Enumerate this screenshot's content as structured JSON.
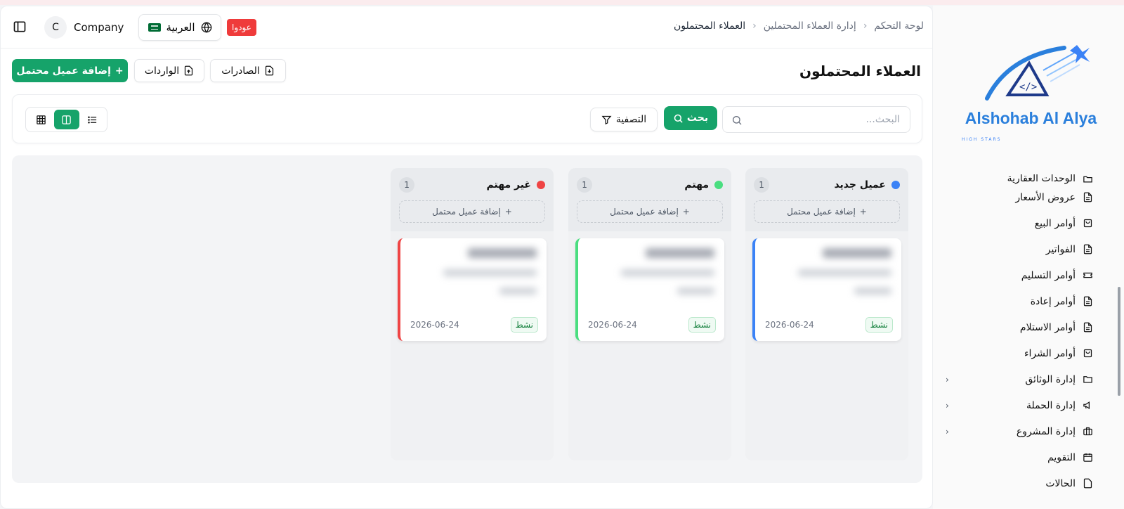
{
  "header": {
    "company_initial": "C",
    "company_name": "Company",
    "language_label": "العربية",
    "back_badge": "عودوا",
    "breadcrumb": [
      "لوحة التحكم",
      "إدارة العملاء المحتملين",
      "العملاء المحتملون"
    ]
  },
  "page": {
    "title": "العملاء المحتملون",
    "add_button": "إضافة عميل محتمل",
    "imports_button": "الواردات",
    "exports_button": "الصادرات"
  },
  "toolbar": {
    "search_placeholder": "البحث...",
    "search_button": "بحث",
    "filter_button": "التصفية"
  },
  "board": {
    "columns": [
      {
        "title": "عميل جديد",
        "count": "1",
        "color": "#3b82f6",
        "add_label": "إضافة عميل محتمل",
        "card": {
          "date": "2026-06-24",
          "status": "نشط"
        }
      },
      {
        "title": "مهتم",
        "count": "1",
        "color": "#4ade80",
        "add_label": "إضافة عميل محتمل",
        "card": {
          "date": "2026-06-24",
          "status": "نشط"
        }
      },
      {
        "title": "غير مهتم",
        "count": "1",
        "color": "#ef4444",
        "add_label": "إضافة عميل محتمل",
        "card": {
          "date": "2026-06-24",
          "status": "نشط"
        }
      }
    ]
  },
  "sidebar": {
    "brand": "Alshohab Al Alya",
    "tagline": "HIGH STARS",
    "items": [
      {
        "label": "الوحدات العقارية",
        "icon": "folder-icon"
      },
      {
        "label": "عروض الأسعار",
        "icon": "document-icon"
      },
      {
        "label": "أوامر البيع",
        "icon": "shopping-bag-icon"
      },
      {
        "label": "الفواتير",
        "icon": "document-icon"
      },
      {
        "label": "أوامر التسليم",
        "icon": "ticket-icon"
      },
      {
        "label": "أوامر إعادة",
        "icon": "document-icon"
      },
      {
        "label": "أوامر الاستلام",
        "icon": "document-icon"
      },
      {
        "label": "أوامر الشراء",
        "icon": "shopping-bag-icon"
      },
      {
        "label": "إدارة الوثائق",
        "icon": "folder-icon"
      },
      {
        "label": "إدارة الحملة",
        "icon": "megaphone-icon"
      },
      {
        "label": "إدارة المشروع",
        "icon": "briefcase-icon"
      },
      {
        "label": "التقويم",
        "icon": "calendar-icon"
      },
      {
        "label": "الحالات",
        "icon": "document-icon"
      }
    ]
  },
  "colors": {
    "accent": "#16a36a",
    "badge": "#ef3b3b"
  }
}
